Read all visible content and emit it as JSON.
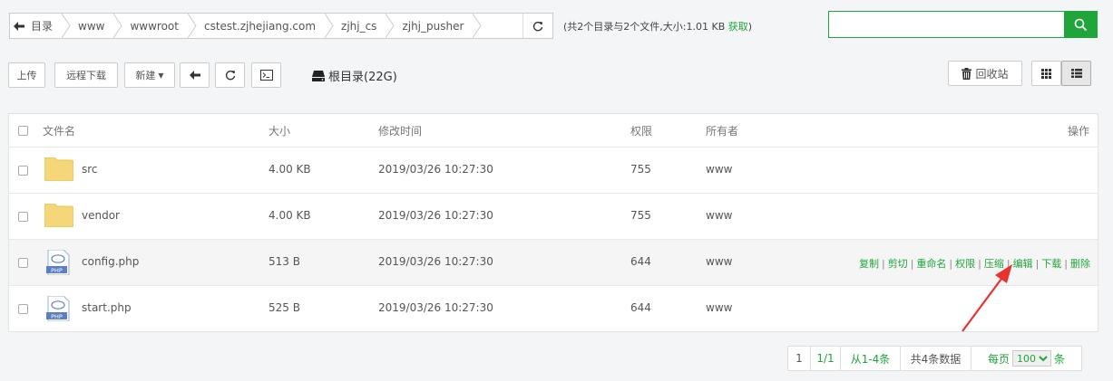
{
  "pathbar": {
    "crumbs": [
      "目录",
      "www",
      "wwwroot",
      "cstest.zjhejiang.com",
      "zjhj_cs",
      "zjhj_pusher"
    ]
  },
  "summary": {
    "text": "(共2个目录与2个文件,大小:1.01 KB ",
    "get_label": "获取",
    "close": ")"
  },
  "search": {
    "placeholder": "",
    "value": ""
  },
  "toolbar": {
    "upload": "上传",
    "remote_download": "远程下载",
    "new": "新建",
    "disk": "根目录(22G)",
    "recycle": "回收站"
  },
  "table": {
    "headers": {
      "name": "文件名",
      "size": "大小",
      "mtime": "修改时间",
      "perm": "权限",
      "owner": "所有者",
      "ops": "操作"
    },
    "rows": [
      {
        "type": "folder",
        "name": "src",
        "size": "4.00 KB",
        "mtime": "2019/03/26 10:27:30",
        "perm": "755",
        "owner": "www"
      },
      {
        "type": "folder",
        "name": "vendor",
        "size": "4.00 KB",
        "mtime": "2019/03/26 10:27:30",
        "perm": "755",
        "owner": "www"
      },
      {
        "type": "php",
        "name": "config.php",
        "size": "513 B",
        "mtime": "2019/03/26 10:27:30",
        "perm": "644",
        "owner": "www"
      },
      {
        "type": "php",
        "name": "start.php",
        "size": "525 B",
        "mtime": "2019/03/26 10:27:30",
        "perm": "644",
        "owner": "www"
      }
    ],
    "ops": [
      "复制",
      "剪切",
      "重命名",
      "权限",
      "压缩",
      "编辑",
      "下载",
      "删除"
    ]
  },
  "pager": {
    "current": "1",
    "total_pages": "1/1",
    "range": "从1-4条",
    "total": "共4条数据",
    "per_page_label": "每页",
    "per_page": "100",
    "unit": "条"
  },
  "php_badge": "PHP",
  "colors": {
    "accent": "#20a53a",
    "arrow": "#e8322d",
    "folder": "#f5d77a"
  },
  "icons": [
    "back-arrow-icon",
    "refresh-icon",
    "search-icon",
    "terminal-icon",
    "hdd-icon",
    "trash-icon",
    "grid-view-icon",
    "list-view-icon",
    "folder-icon",
    "php-file-icon"
  ]
}
